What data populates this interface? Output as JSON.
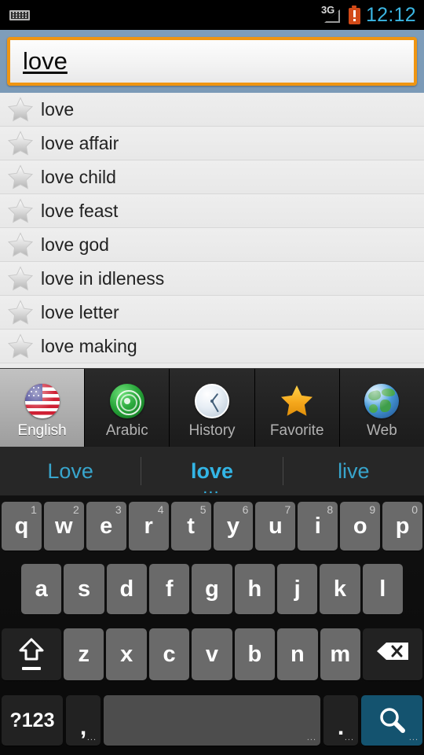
{
  "status_bar": {
    "keyboard_icon": "keyboard-icon",
    "network_label": "3G",
    "signal_icon": "signal-triangle-empty-icon",
    "battery_icon": "battery-warning-icon",
    "time": "12:12",
    "time_color": "#33b5e5"
  },
  "search": {
    "value": "love",
    "border_color": "#ef9512",
    "bar_background": "#7e9dba"
  },
  "results": [
    {
      "label": "love",
      "icon": "star-icon"
    },
    {
      "label": "love affair",
      "icon": "star-icon"
    },
    {
      "label": "love child",
      "icon": "star-icon"
    },
    {
      "label": "love feast",
      "icon": "star-icon"
    },
    {
      "label": "love god",
      "icon": "star-icon"
    },
    {
      "label": "love in idleness",
      "icon": "star-icon"
    },
    {
      "label": "love letter",
      "icon": "star-icon"
    },
    {
      "label": "love making",
      "icon": "star-icon"
    }
  ],
  "tabs": [
    {
      "label": "English",
      "icon": "us-flag-icon",
      "selected": true
    },
    {
      "label": "Arabic",
      "icon": "arabic-emblem-icon",
      "selected": false
    },
    {
      "label": "History",
      "icon": "clock-icon",
      "selected": false
    },
    {
      "label": "Favorite",
      "icon": "star-gold-icon",
      "selected": false
    },
    {
      "label": "Web",
      "icon": "globe-icon",
      "selected": false
    }
  ],
  "suggestions": [
    {
      "text": "Love",
      "selected": false
    },
    {
      "text": "love",
      "selected": true
    },
    {
      "text": "live",
      "selected": false
    }
  ],
  "keyboard": {
    "row1": [
      {
        "key": "q",
        "num": "1"
      },
      {
        "key": "w",
        "num": "2"
      },
      {
        "key": "e",
        "num": "3"
      },
      {
        "key": "r",
        "num": "4"
      },
      {
        "key": "t",
        "num": "5"
      },
      {
        "key": "y",
        "num": "6"
      },
      {
        "key": "u",
        "num": "7"
      },
      {
        "key": "i",
        "num": "8"
      },
      {
        "key": "o",
        "num": "9"
      },
      {
        "key": "p",
        "num": "0"
      }
    ],
    "row2": [
      {
        "key": "a"
      },
      {
        "key": "s"
      },
      {
        "key": "d"
      },
      {
        "key": "f"
      },
      {
        "key": "g"
      },
      {
        "key": "h"
      },
      {
        "key": "j"
      },
      {
        "key": "k"
      },
      {
        "key": "l"
      }
    ],
    "row3": [
      {
        "key": "z"
      },
      {
        "key": "x"
      },
      {
        "key": "c"
      },
      {
        "key": "v"
      },
      {
        "key": "b"
      },
      {
        "key": "n"
      },
      {
        "key": "m"
      }
    ],
    "shift_label": "shift-key",
    "delete_label": "delete-key",
    "symbols_label": "?123",
    "comma_label": ",",
    "space_label": "",
    "period_label": ".",
    "search_label": "search-key",
    "search_key_color": "#14536f",
    "long_press_hint": "..."
  }
}
